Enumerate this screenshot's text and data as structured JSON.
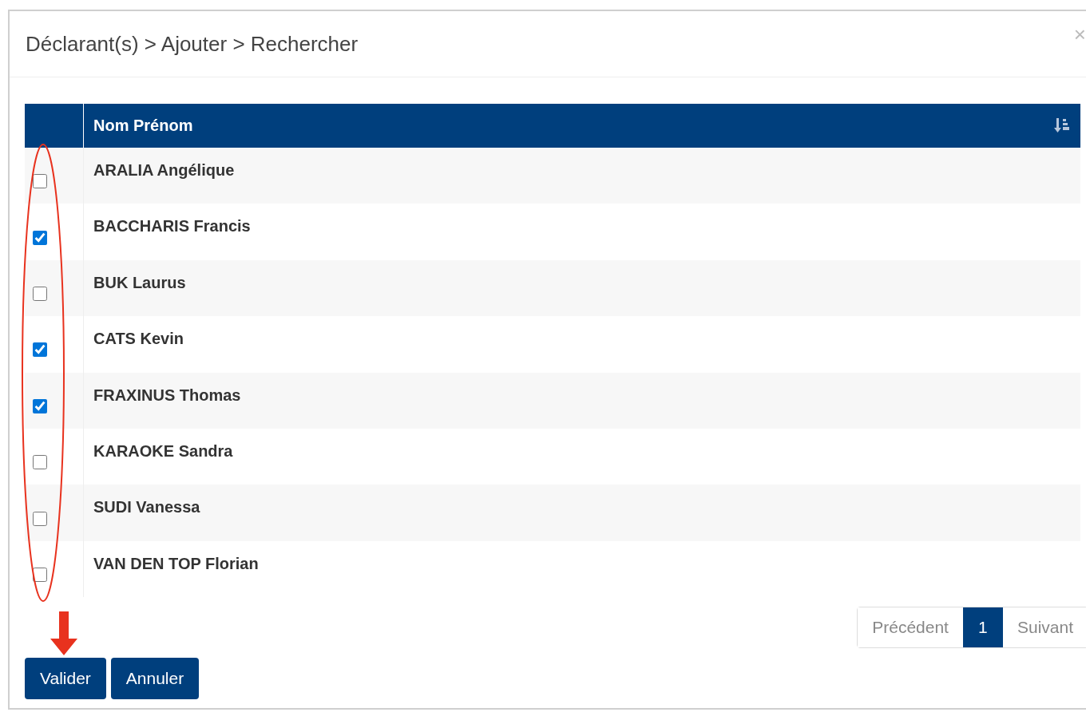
{
  "dialog": {
    "title": "Déclarant(s) > Ajouter > Rechercher",
    "close": "×"
  },
  "table": {
    "columns": [
      "Nom Prénom"
    ],
    "rows": [
      {
        "name": "ARALIA Angélique",
        "checked": false
      },
      {
        "name": "BACCHARIS Francis",
        "checked": true
      },
      {
        "name": "BUK Laurus",
        "checked": false
      },
      {
        "name": "CATS Kevin",
        "checked": true
      },
      {
        "name": "FRAXINUS Thomas",
        "checked": true
      },
      {
        "name": "KARAOKE Sandra",
        "checked": false
      },
      {
        "name": "SUDI Vanessa",
        "checked": false
      },
      {
        "name": "VAN DEN TOP Florian",
        "checked": false
      }
    ]
  },
  "pagination": {
    "previous": "Précédent",
    "pages": [
      {
        "label": "1",
        "selected": true
      }
    ],
    "next": "Suivant"
  },
  "buttons": [
    "Valider",
    "Annuler"
  ]
}
